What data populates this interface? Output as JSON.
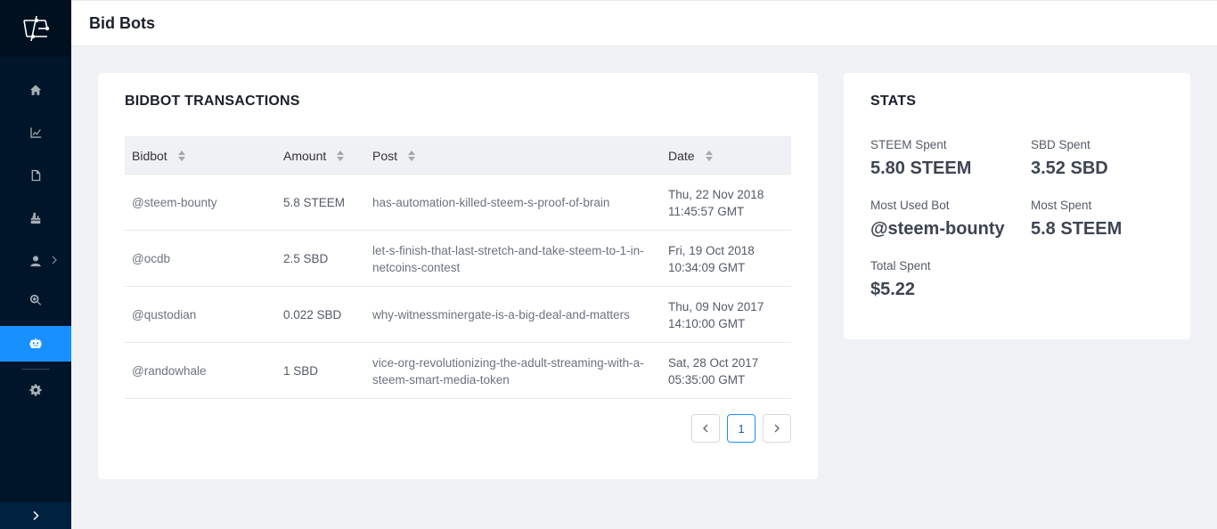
{
  "header": {
    "title": "Bid Bots"
  },
  "transactions": {
    "title": "BIDBOT TRANSACTIONS",
    "columns": [
      "Bidbot",
      "Amount",
      "Post",
      "Date"
    ],
    "rows": [
      {
        "bidbot": "@steem-bounty",
        "amount": "5.8 STEEM",
        "post": "has-automation-killed-steem-s-proof-of-brain",
        "date": "Thu, 22 Nov 2018 11:45:57 GMT"
      },
      {
        "bidbot": "@ocdb",
        "amount": "2.5 SBD",
        "post": "let-s-finish-that-last-stretch-and-take-steem-to-1-in-netcoins-contest",
        "date": "Fri, 19 Oct 2018 10:34:09 GMT"
      },
      {
        "bidbot": "@qustodian",
        "amount": "0.022 SBD",
        "post": "why-witnessminergate-is-a-big-deal-and-matters",
        "date": "Thu, 09 Nov 2017 14:10:00 GMT"
      },
      {
        "bidbot": "@randowhale",
        "amount": "1 SBD",
        "post": "vice-org-revolutionizing-the-adult-streaming-with-a-steem-smart-media-token",
        "date": "Sat, 28 Oct 2017 05:35:00 GMT"
      }
    ],
    "pagination": {
      "current": "1"
    }
  },
  "stats": {
    "title": "STATS",
    "steem_spent_label": "STEEM Spent",
    "steem_spent_value": "5.80 STEEM",
    "sbd_spent_label": "SBD Spent",
    "sbd_spent_value": "3.52 SBD",
    "most_used_label": "Most Used Bot",
    "most_used_value": "@steem-bounty",
    "most_spent_label": "Most Spent",
    "most_spent_value": "5.8 STEEM",
    "total_label": "Total Spent",
    "total_value": "$5.22"
  },
  "sidebar": {
    "items": [
      "home-icon",
      "line-chart-icon",
      "file-icon",
      "vote-icon",
      "user-icon",
      "search-icon",
      "robot-icon",
      "settings-icon"
    ],
    "active": "robot-icon"
  },
  "colors": {
    "sidebar": "#001529",
    "accent": "#1890ff"
  }
}
